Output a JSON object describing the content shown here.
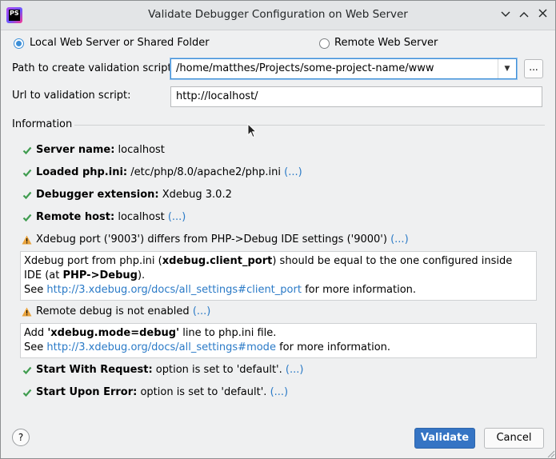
{
  "window": {
    "title": "Validate Debugger Configuration on Web Server",
    "app_icon_text": "PS",
    "controls": [
      "⌄",
      "⌃",
      "✕"
    ]
  },
  "mode": {
    "local_label": "Local Web Server or Shared Folder",
    "remote_label": "Remote Web Server",
    "selected": "local"
  },
  "form": {
    "path_label": "Path to create validation script:",
    "path_value": "/home/matthes/Projects/some-project-name/www",
    "browse_label": "...",
    "url_label": "Url to validation script:",
    "url_value": "http://localhost/"
  },
  "info": {
    "section_label": "Information",
    "server_name": {
      "key": "Server name:",
      "value": " localhost"
    },
    "loaded_ini": {
      "key": "Loaded php.ini:",
      "value": " /etc/php/8.0/apache2/php.ini ",
      "more": "(...)"
    },
    "debugger_ext": {
      "key": "Debugger extension:",
      "value": " Xdebug 3.0.2"
    },
    "remote_host": {
      "key": "Remote host:",
      "value": " localhost ",
      "more": "(...)"
    },
    "port_warning": {
      "text": "Xdebug port ('9003') differs from PHP->Debug IDE settings ('9000') ",
      "more": "(...)"
    },
    "port_box": {
      "t1": "Xdebug port from php.ini (",
      "b1": "xdebug.client_port",
      "t2": ") should be equal to the one configured inside IDE (at ",
      "b2": "PHP->Debug",
      "t3": ").",
      "see": "See ",
      "link": "http://3.xdebug.org/docs/all_settings#client_port",
      "tail": " for more information."
    },
    "remote_debug_warning": {
      "text": "Remote debug is not enabled ",
      "more": "(...)"
    },
    "mode_box": {
      "t1": "Add ",
      "b1": "'xdebug.mode=debug'",
      "t2": " line to php.ini file.",
      "see": "See ",
      "link": "http://3.xdebug.org/docs/all_settings#mode",
      "tail": " for more information."
    },
    "start_with_request": {
      "key": "Start With Request:",
      "value": " option is set to 'default'. ",
      "more": "(...)"
    },
    "start_upon_error": {
      "key": "Start Upon Error:",
      "value": " option is set to 'default'. ",
      "more": "(...)"
    }
  },
  "footer": {
    "help": "?",
    "validate": "Validate",
    "cancel": "Cancel"
  },
  "colors": {
    "accent": "#3574c4",
    "link": "#2a7ac7",
    "check": "#3f9c4f",
    "warning": "#e8a33d"
  }
}
